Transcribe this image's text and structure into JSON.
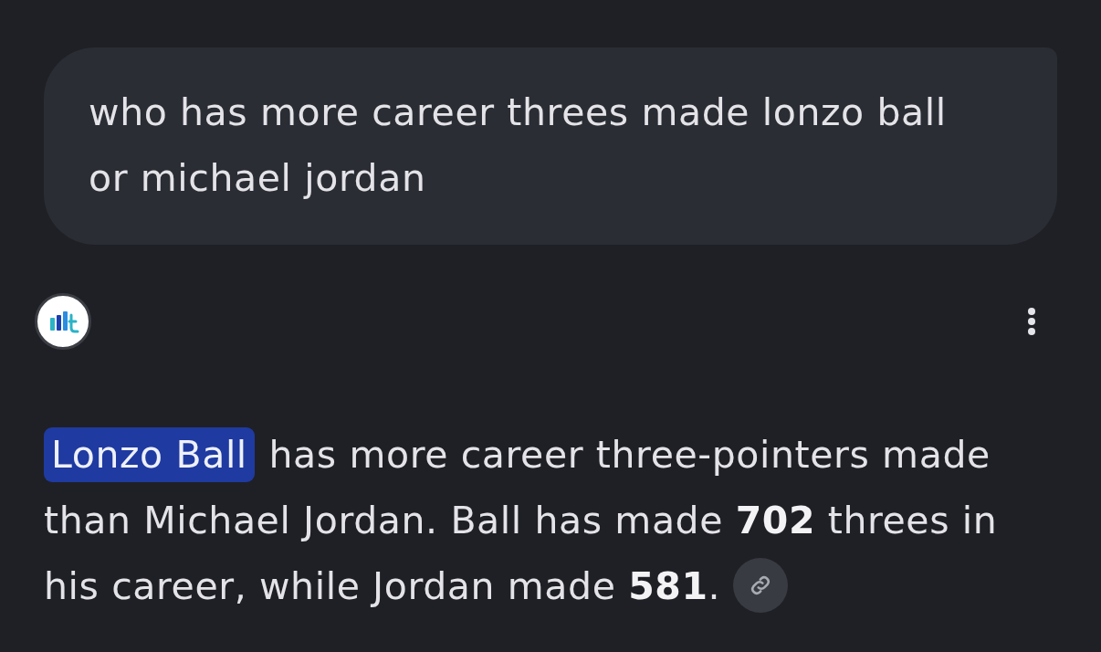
{
  "query": {
    "text": "who has more career threes made lonzo ball or michael jordan"
  },
  "response": {
    "highlight": "Lonzo Ball",
    "text": "has more career three-pointers made than Michael Jordan. Ball has made **702** threes in his career, while Jordan made **581**."
  }
}
